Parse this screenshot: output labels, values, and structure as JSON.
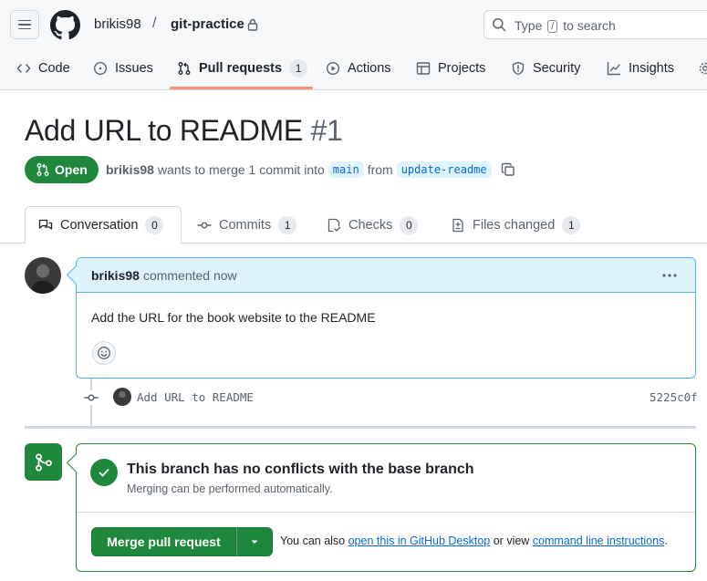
{
  "header": {
    "owner": "brikis98",
    "separator": "/",
    "repo": "git-practice",
    "search": {
      "prefix": "Type",
      "key": "/",
      "suffix": "to search"
    }
  },
  "repo_nav": {
    "items": [
      {
        "label": "Code",
        "icon": "code-icon"
      },
      {
        "label": "Issues",
        "icon": "issue-opened-icon"
      },
      {
        "label": "Pull requests",
        "icon": "git-pull-request-icon",
        "count": "1",
        "active": true
      },
      {
        "label": "Actions",
        "icon": "play-icon"
      },
      {
        "label": "Projects",
        "icon": "table-icon"
      },
      {
        "label": "Security",
        "icon": "shield-icon"
      },
      {
        "label": "Insights",
        "icon": "graph-icon"
      }
    ]
  },
  "pr": {
    "title": "Add URL to README",
    "number": "#1",
    "state": "Open",
    "author": "brikis98",
    "meta_text": "wants to merge 1 commit into",
    "base_branch": "main",
    "from_text": "from",
    "head_branch": "update-readme"
  },
  "tabs": [
    {
      "label": "Conversation",
      "count": "0",
      "icon": "comment-discussion-icon"
    },
    {
      "label": "Commits",
      "count": "1",
      "icon": "git-commit-icon"
    },
    {
      "label": "Checks",
      "count": "0",
      "icon": "checklist-icon"
    },
    {
      "label": "Files changed",
      "count": "1",
      "icon": "file-diff-icon"
    }
  ],
  "comment": {
    "author": "brikis98",
    "action": "commented now",
    "body": "Add the URL for the book website to the README"
  },
  "commit": {
    "message": "Add URL to README",
    "sha": "5225c0f"
  },
  "merge": {
    "title": "This branch has no conflicts with the base branch",
    "subtitle": "Merging can be performed automatically.",
    "button": "Merge pull request",
    "hint_prefix": "You can also",
    "hint_link1": "open this in GitHub Desktop",
    "hint_middle": "or view",
    "hint_link2": "command line instructions",
    "hint_suffix": "."
  },
  "colors": {
    "accent_green": "#1f883d",
    "link_blue": "#0969da",
    "nav_underline": "#fd8c73",
    "comment_header": "#ddf4ff"
  }
}
